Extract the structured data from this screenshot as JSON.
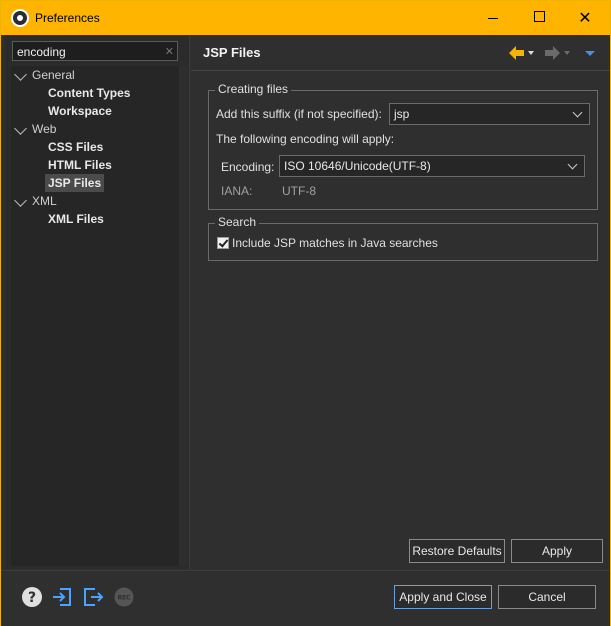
{
  "window": {
    "title": "Preferences",
    "minimize_icon": "minimize-icon",
    "maximize_icon": "maximize-icon",
    "close_icon": "close-icon"
  },
  "filter": {
    "value": "encoding",
    "clear_icon": "clear-icon"
  },
  "tree": {
    "items": [
      {
        "label": "General",
        "kind": "category",
        "expanded": true
      },
      {
        "label": "Content Types",
        "kind": "leaf"
      },
      {
        "label": "Workspace",
        "kind": "leaf"
      },
      {
        "label": "Web",
        "kind": "category",
        "expanded": true
      },
      {
        "label": "CSS Files",
        "kind": "leaf"
      },
      {
        "label": "HTML Files",
        "kind": "leaf"
      },
      {
        "label": "JSP Files",
        "kind": "leaf",
        "selected": true
      },
      {
        "label": "XML",
        "kind": "category",
        "expanded": true
      },
      {
        "label": "XML Files",
        "kind": "leaf"
      }
    ]
  },
  "page": {
    "title": "JSP Files",
    "nav": {
      "back_icon": "back-arrow-icon",
      "forward_icon": "forward-arrow-icon",
      "menu_icon": "view-menu-icon",
      "back_color": "#f5b400"
    }
  },
  "creating_files": {
    "legend": "Creating files",
    "suffix_label": "Add this suffix (if not specified):",
    "suffix_value": "jsp",
    "encoding_note": "The following encoding will apply:",
    "encoding_label": "Encoding:",
    "encoding_value": "ISO 10646/Unicode(UTF-8)",
    "iana_label": "IANA:",
    "iana_value": "UTF-8"
  },
  "search": {
    "legend": "Search",
    "include_label": "Include JSP matches in Java searches",
    "include_checked": true
  },
  "buttons": {
    "restore_defaults": "Restore Defaults",
    "apply": "Apply",
    "apply_and_close": "Apply and Close",
    "cancel": "Cancel"
  },
  "bottom_icons": [
    "help-icon",
    "import-icon",
    "export-icon",
    "record-icon"
  ],
  "record_text": "REC"
}
